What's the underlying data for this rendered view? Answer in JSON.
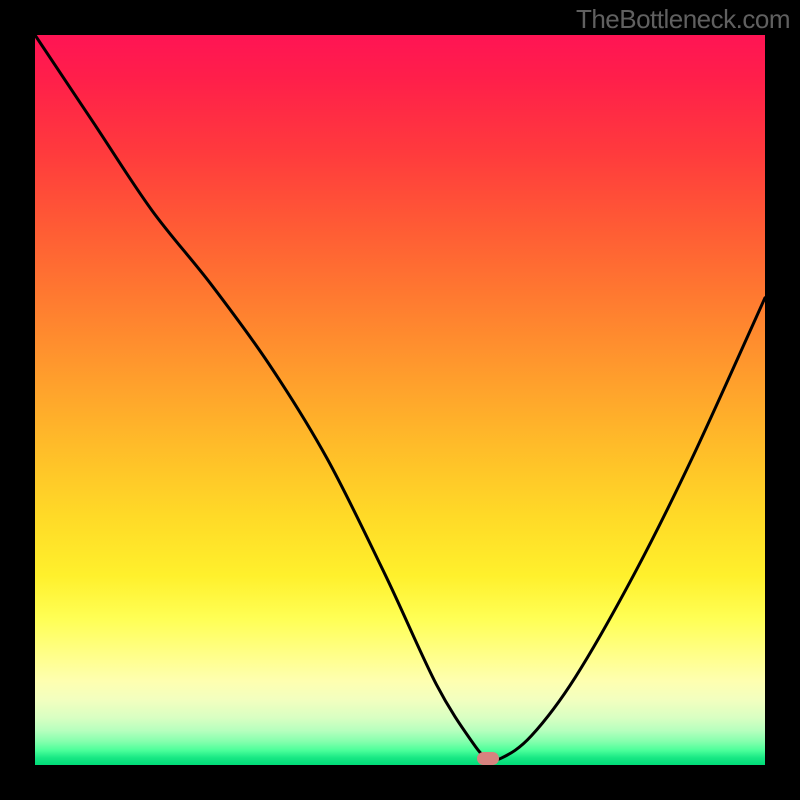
{
  "watermark": "TheBottleneck.com",
  "marker": {
    "x_pct": 62,
    "y_pct": 99
  },
  "chart_data": {
    "type": "line",
    "title": "",
    "xlabel": "",
    "ylabel": "",
    "xlim": [
      0,
      100
    ],
    "ylim": [
      0,
      100
    ],
    "grid": false,
    "legend": false,
    "series": [
      {
        "name": "curve",
        "x": [
          0,
          8,
          16,
          24,
          32,
          40,
          48,
          55,
          60,
          62,
          64,
          68,
          74,
          82,
          90,
          100
        ],
        "y": [
          100,
          88,
          76,
          66,
          55,
          42,
          26,
          11,
          3,
          1,
          1,
          4,
          12,
          26,
          42,
          64
        ]
      }
    ],
    "background_gradient_stops": [
      {
        "pct": 0,
        "color": "#ff1454"
      },
      {
        "pct": 48,
        "color": "#ffa12c"
      },
      {
        "pct": 74,
        "color": "#fff02c"
      },
      {
        "pct": 91,
        "color": "#f3ffbf"
      },
      {
        "pct": 100,
        "color": "#00db78"
      }
    ]
  }
}
